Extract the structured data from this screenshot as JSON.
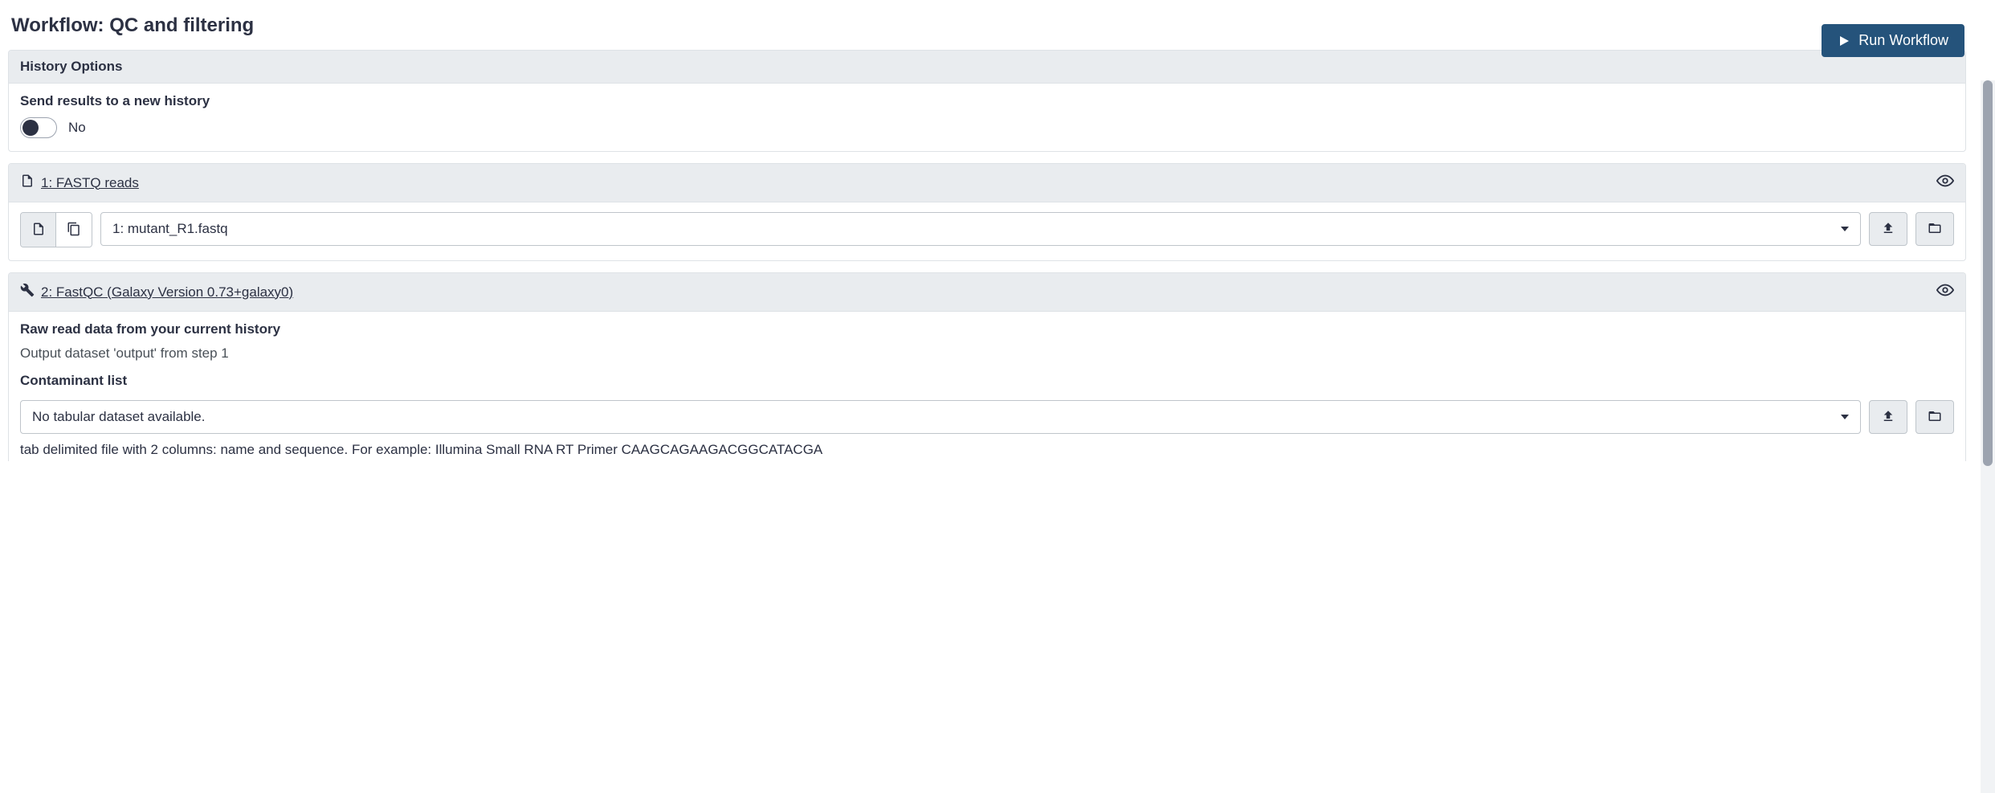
{
  "page_title": "Workflow: QC and filtering",
  "run_button_label": "Run Workflow",
  "history_options": {
    "header": "History Options",
    "send_results_label": "Send results to a new history",
    "send_results_value": "No"
  },
  "step1": {
    "title": "1: FASTQ reads",
    "selected_dataset": "1: mutant_R1.fastq"
  },
  "step2": {
    "title": "2: FastQC (Galaxy Version 0.73+galaxy0)",
    "raw_read_label": "Raw read data from your current history",
    "raw_read_value": "Output dataset 'output' from step 1",
    "contaminant_label": "Contaminant list",
    "contaminant_selected": "No tabular dataset available.",
    "contaminant_help": "tab delimited file with 2 columns: name and sequence. For example: Illumina Small RNA RT Primer CAAGCAGAAGACGGCATACGA"
  }
}
